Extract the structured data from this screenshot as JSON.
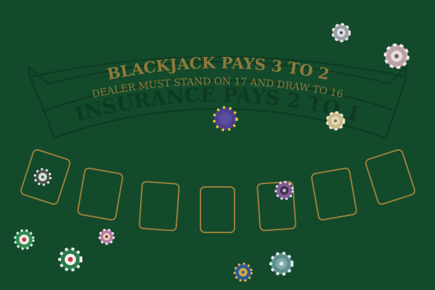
{
  "table": {
    "felt_color": "#134a2b",
    "ink_gold": "#8f7a3c",
    "ink_dark": "#0f3a22",
    "line_color": "#9a7f3a"
  },
  "text": {
    "pays": "BLACKJACK PAYS 3 TO 2",
    "dealer_rule": "DEALER MUST STAND ON 17 AND DRAW TO 16",
    "insurance": "INSURANCE PAYS 2 TO 1"
  },
  "betting_spots": [
    {
      "name": "betting-spot-1"
    },
    {
      "name": "betting-spot-2"
    },
    {
      "name": "betting-spot-3"
    },
    {
      "name": "betting-spot-4"
    },
    {
      "name": "betting-spot-5"
    },
    {
      "name": "betting-spot-6"
    },
    {
      "name": "betting-spot-7"
    }
  ],
  "chips": [
    {
      "name": "chip-silver-top",
      "color": "#9aa0a6",
      "edge": "#eeeeee"
    },
    {
      "name": "chip-tan-top-right",
      "color": "#b9a3a8",
      "edge": "#f1e7e7"
    },
    {
      "name": "chip-purple-center",
      "color": "#4d3f8e",
      "edge": "#f0cc2e"
    },
    {
      "name": "chip-khaki-right",
      "color": "#c7b98c",
      "edge": "#f4ecd0"
    },
    {
      "name": "chip-dark-spot-1",
      "color": "#49504a",
      "edge": "#e8ece8"
    },
    {
      "name": "chip-purple-spot-5",
      "color": "#7d5b93",
      "edge": "#e9dcf0"
    },
    {
      "name": "chip-green-bottom-left",
      "color": "#2e8b4d",
      "edge": "#f1f1f1"
    },
    {
      "name": "chip-pink-bottom",
      "color": "#b57ba6",
      "edge": "#f5e5ef"
    },
    {
      "name": "chip-green-red-bottom",
      "color": "#2a7a4a",
      "edge": "#f2f2f2"
    },
    {
      "name": "chip-blue-bottom",
      "color": "#2e5d8e",
      "edge": "#e8b04a"
    },
    {
      "name": "chip-teal-bottom",
      "color": "#5d8d8c",
      "edge": "#dfeceb"
    }
  ]
}
